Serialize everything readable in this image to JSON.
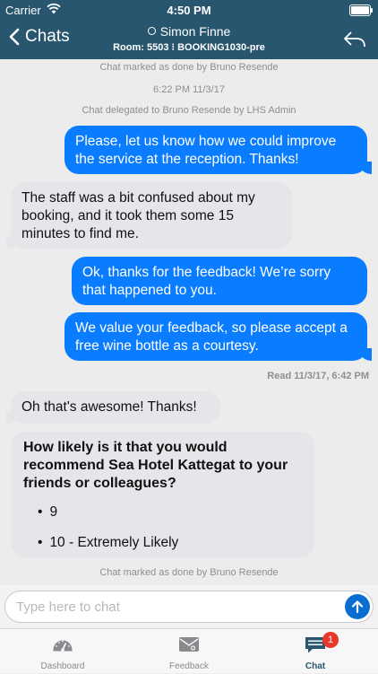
{
  "status_bar": {
    "carrier": "Carrier",
    "time": "4:50 PM"
  },
  "header": {
    "back_label": "Chats",
    "title": "Simon Finne",
    "subtitle": "Room: 5503 ⁝ BOOKING1030-pre"
  },
  "messages": [
    {
      "kind": "system",
      "text": "Chat marked as done by Bruno Resende"
    },
    {
      "kind": "system",
      "text": "6:22 PM  11/3/17"
    },
    {
      "kind": "system",
      "text": "Chat delegated to Bruno Resende by LHS Admin"
    },
    {
      "kind": "outgoing",
      "text": "Please, let us know how we could improve the service at the reception. Thanks!"
    },
    {
      "kind": "incoming",
      "text": "The staff was a bit confused about my booking, and it took them some 15 minutes to find me."
    },
    {
      "kind": "outgoing",
      "text": "Ok, thanks for the feedback! We’re sorry that happened to you."
    },
    {
      "kind": "outgoing",
      "text": "We value your feedback, so please accept a free wine bottle as a courtesy."
    },
    {
      "kind": "read_receipt",
      "text": "Read 11/3/17, 6:42 PM"
    },
    {
      "kind": "incoming",
      "text": "Oh that's awesome! Thanks!"
    },
    {
      "kind": "survey",
      "question": "How likely is it that you would recommend Sea Hotel Kattegat to your friends or colleagues?",
      "options": [
        "9",
        "10 - Extremely Likely"
      ]
    },
    {
      "kind": "system",
      "text": "Chat marked as done by Bruno Resende"
    }
  ],
  "composer": {
    "placeholder": "Type here to chat",
    "value": ""
  },
  "tabs": [
    {
      "label": "Dashboard",
      "icon": "speedometer-icon",
      "active": false
    },
    {
      "label": "Feedback",
      "icon": "feedback-icon",
      "active": false
    },
    {
      "label": "Chat",
      "icon": "chat-icon",
      "active": true,
      "badge": "1"
    }
  ],
  "colors": {
    "header_bg": "#27566e",
    "outgoing_bubble": "#0a7cff",
    "incoming_bubble": "#e5e5ea",
    "badge": "#e8372d",
    "send_button": "#0a6ed1"
  }
}
